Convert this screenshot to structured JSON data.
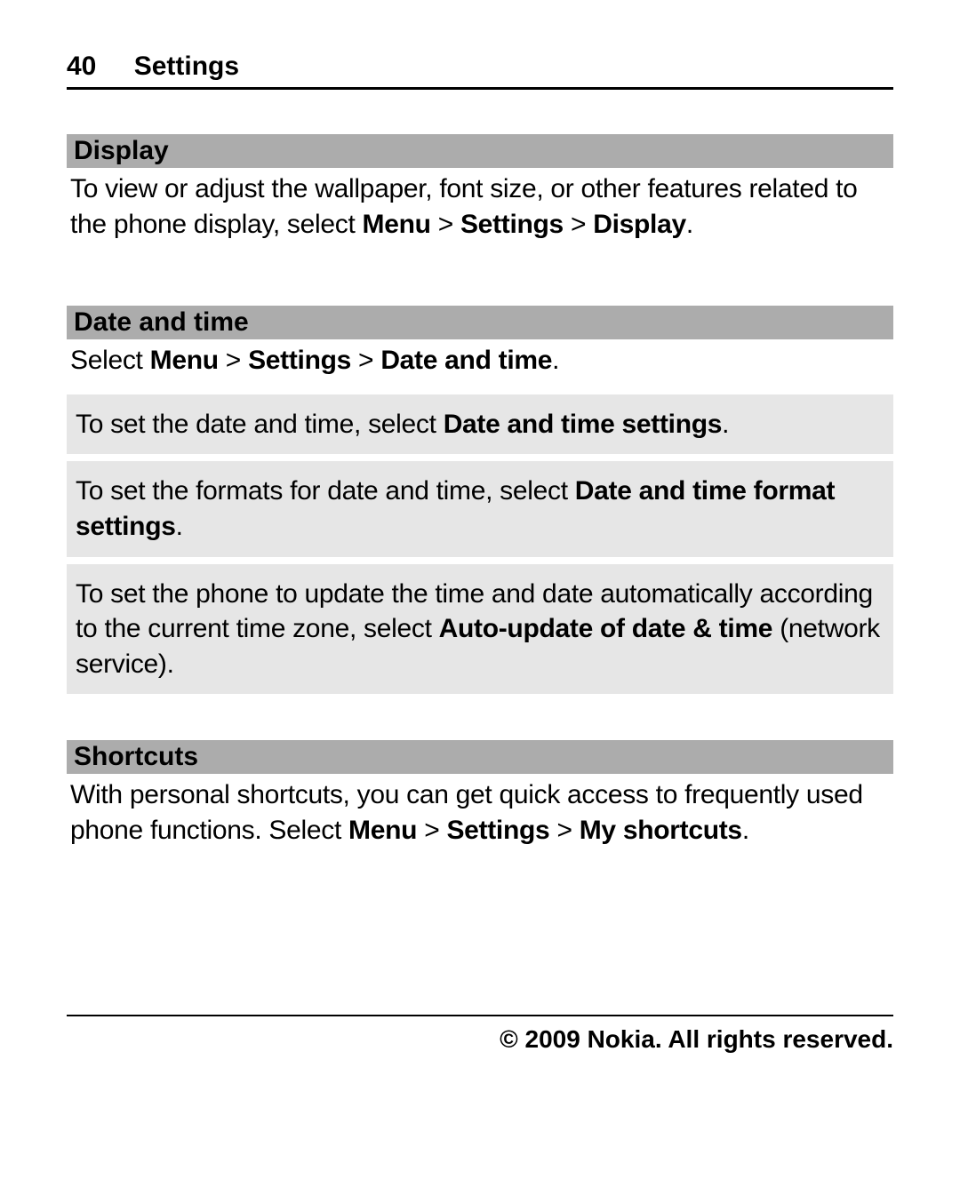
{
  "header": {
    "page_number": "40",
    "title": "Settings"
  },
  "sections": {
    "display": {
      "heading": "Display",
      "text_pre": "To view or adjust the wallpaper, font size, or other features related to the phone display, select ",
      "path1": "Menu",
      "sep": " > ",
      "path2": "Settings",
      "path3": "Display",
      "period": "."
    },
    "datetime": {
      "heading": "Date and time",
      "intro_pre": "Select ",
      "intro_p1": "Menu",
      "intro_sep": " > ",
      "intro_p2": "Settings",
      "intro_p3": "Date and time",
      "intro_post": ".",
      "box1_pre": "To set the date and time, select ",
      "box1_bold": "Date and time settings",
      "box1_post": ".",
      "box2_pre": "To set the formats for date and time, select ",
      "box2_bold": "Date and time format settings",
      "box2_post": ".",
      "box3_pre": "To set the phone to update the time and date automatically according to the current time zone, select ",
      "box3_bold": "Auto-update of date & time",
      "box3_post": " (network service)."
    },
    "shortcuts": {
      "heading": "Shortcuts",
      "text_pre": "With personal shortcuts, you can get quick access to frequently used phone functions. Select ",
      "p1": "Menu",
      "sep": " > ",
      "p2": "Settings",
      "p3": "My shortcuts",
      "post": "."
    }
  },
  "footer": "© 2009 Nokia. All rights reserved."
}
